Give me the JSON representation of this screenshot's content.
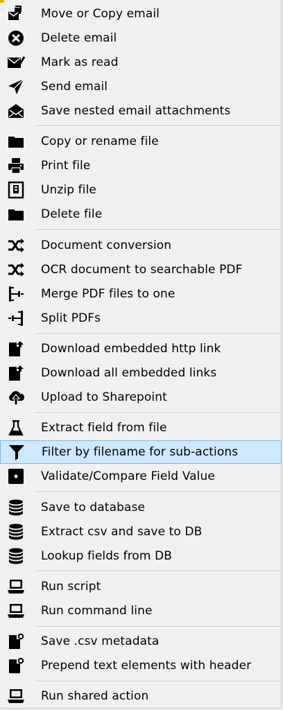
{
  "menu": {
    "items": [
      {
        "label": "Move or Copy email",
        "icon": "move-copy-email-icon"
      },
      {
        "label": "Delete email",
        "icon": "delete-circle-icon"
      },
      {
        "label": "Mark as read",
        "icon": "envelope-check-icon"
      },
      {
        "label": "Send email",
        "icon": "paper-plane-icon"
      },
      {
        "label": "Save nested email attachments",
        "icon": "open-envelope-icon"
      },
      {
        "label": "Copy or rename file",
        "icon": "folder-icon"
      },
      {
        "label": "Print file",
        "icon": "printer-icon"
      },
      {
        "label": "Unzip file",
        "icon": "zip-file-icon"
      },
      {
        "label": "Delete file",
        "icon": "folder-icon"
      },
      {
        "label": "Document conversion",
        "icon": "shuffle-icon"
      },
      {
        "label": "OCR document to searchable PDF",
        "icon": "shuffle-icon"
      },
      {
        "label": "Merge PDF files to one",
        "icon": "merge-icon"
      },
      {
        "label": "Split PDFs",
        "icon": "split-icon"
      },
      {
        "label": "Download embedded http link",
        "icon": "file-upload-icon"
      },
      {
        "label": "Download all embedded links",
        "icon": "file-upload-icon"
      },
      {
        "label": "Upload to Sharepoint",
        "icon": "cloud-upload-icon"
      },
      {
        "label": "Extract field from file",
        "icon": "flask-icon"
      },
      {
        "label": "Filter by filename for sub-actions",
        "icon": "filter-icon"
      },
      {
        "label": "Validate/Compare Field Value",
        "icon": "square-dot-icon"
      },
      {
        "label": "Save to database",
        "icon": "database-icon"
      },
      {
        "label": "Extract csv and save to DB",
        "icon": "database-icon"
      },
      {
        "label": "Lookup fields from DB",
        "icon": "database-icon"
      },
      {
        "label": "Run script",
        "icon": "laptop-icon"
      },
      {
        "label": "Run command line",
        "icon": "laptop-icon"
      },
      {
        "label": "Save .csv metadata",
        "icon": "file-gear-icon"
      },
      {
        "label": "Prepend text elements with header",
        "icon": "file-gear-icon"
      },
      {
        "label": "Run shared action",
        "icon": "laptop-icon"
      }
    ],
    "highlighted": "Filter by filename for sub-actions",
    "highlight_color": "#cde8ff",
    "highlight_border": "#78b7e8"
  }
}
